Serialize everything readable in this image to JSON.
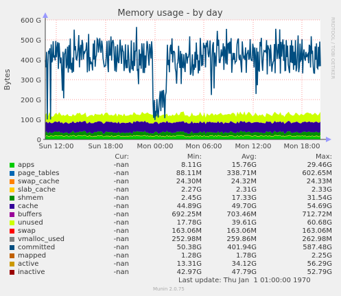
{
  "chart_data": {
    "type": "area",
    "title": "Memory usage - by day",
    "ylabel": "Bytes",
    "side_label": "RRDTOOL / TOBI OETIKER",
    "ylim": [
      0,
      600
    ],
    "y_unit": "G",
    "yticks": [
      "0",
      "100 G",
      "200 G",
      "300 G",
      "400 G",
      "500 G",
      "600 G"
    ],
    "xticks": [
      "Sun 12:00",
      "Sun 18:00",
      "Mon 00:00",
      "Mon 06:00",
      "Mon 12:00",
      "Mon 18:00"
    ],
    "grid": true,
    "columns": [
      "Cur:",
      "Min:",
      "Avg:",
      "Max:"
    ],
    "series": [
      {
        "name": "apps",
        "color": "#00cc00",
        "cur": "-nan",
        "min": "8.11G",
        "avg": "15.76G",
        "max": "29.46G"
      },
      {
        "name": "page_tables",
        "color": "#0066b3",
        "cur": "-nan",
        "min": "88.11M",
        "avg": "338.71M",
        "max": "602.65M"
      },
      {
        "name": "swap_cache",
        "color": "#ff8000",
        "cur": "-nan",
        "min": "24.30M",
        "avg": "24.32M",
        "max": "24.33M"
      },
      {
        "name": "slab_cache",
        "color": "#ffcc00",
        "cur": "-nan",
        "min": "2.27G",
        "avg": "2.31G",
        "max": "2.33G"
      },
      {
        "name": "shmem",
        "color": "#008f00",
        "cur": "-nan",
        "min": "2.45G",
        "avg": "17.33G",
        "max": "31.54G"
      },
      {
        "name": "cache",
        "color": "#330099",
        "cur": "-nan",
        "min": "44.89G",
        "avg": "49.70G",
        "max": "54.69G"
      },
      {
        "name": "buffers",
        "color": "#990099",
        "cur": "-nan",
        "min": "692.25M",
        "avg": "703.46M",
        "max": "712.72M"
      },
      {
        "name": "unused",
        "color": "#ccff00",
        "cur": "-nan",
        "min": "17.78G",
        "avg": "39.61G",
        "max": "60.68G"
      },
      {
        "name": "swap",
        "color": "#ff0000",
        "cur": "-nan",
        "min": "163.06M",
        "avg": "163.06M",
        "max": "163.06M"
      },
      {
        "name": "vmalloc_used",
        "color": "#808080",
        "cur": "-nan",
        "min": "252.98M",
        "avg": "259.86M",
        "max": "262.98M"
      },
      {
        "name": "committed",
        "color": "#004d80",
        "cur": "-nan",
        "min": "50.38G",
        "avg": "401.94G",
        "max": "587.48G"
      },
      {
        "name": "mapped",
        "color": "#c06000",
        "cur": "-nan",
        "min": "1.28G",
        "avg": "1.78G",
        "max": "2.25G"
      },
      {
        "name": "active",
        "color": "#cc9900",
        "cur": "-nan",
        "min": "13.31G",
        "avg": "34.12G",
        "max": "56.29G"
      },
      {
        "name": "inactive",
        "color": "#990000",
        "cur": "-nan",
        "min": "42.97G",
        "avg": "47.79G",
        "max": "52.79G"
      }
    ],
    "last_update": "Last update: Thu Jan  1 01:00:00 1970",
    "footer": "Munin 2.0.75"
  },
  "colors": {
    "background": "#f0f0f0",
    "plot_background": "#ffffff",
    "grid": "#ff9a9a",
    "axis": "#444444",
    "arrow": "#9999ff"
  }
}
